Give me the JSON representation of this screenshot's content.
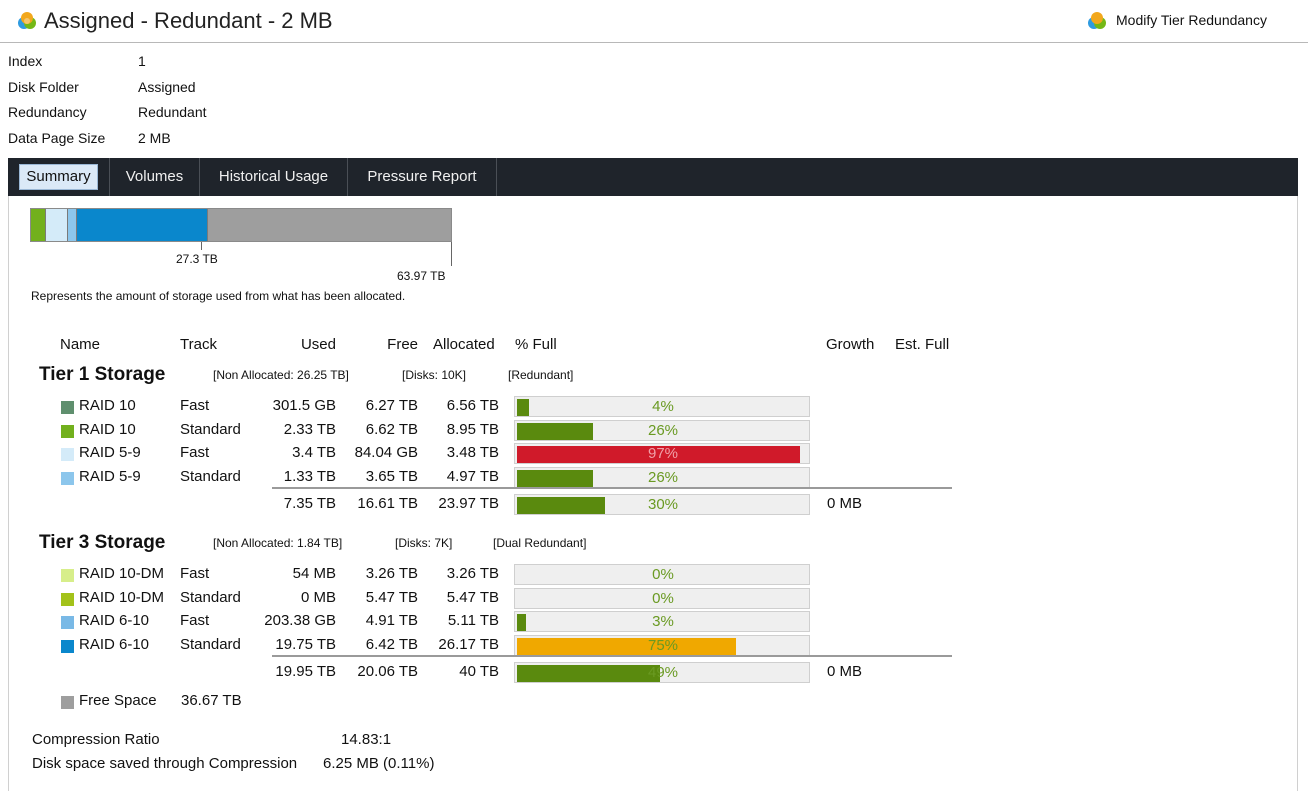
{
  "header": {
    "title": "Assigned - Redundant - 2 MB",
    "modify_label": "Modify Tier Redundancy"
  },
  "properties": [
    {
      "label": "Index",
      "value": "1"
    },
    {
      "label": "Disk Folder",
      "value": "Assigned"
    },
    {
      "label": "Redundancy",
      "value": "Redundant"
    },
    {
      "label": "Data Page Size",
      "value": "2 MB"
    }
  ],
  "tabs": [
    {
      "label": "Summary",
      "active": true
    },
    {
      "label": "Volumes",
      "active": false
    },
    {
      "label": "Historical Usage",
      "active": false
    },
    {
      "label": "Pressure Report",
      "active": false
    }
  ],
  "usage_bar": {
    "used_label": "27.3 TB",
    "allocated_label": "63.97 TB",
    "caption": "Represents the amount of storage used from what has been allocated.",
    "used_fraction": 0.427,
    "segments": [
      {
        "color": "#72b01d",
        "value_tb": 2.33
      },
      {
        "color": "#d4ebf9",
        "value_tb": 3.4
      },
      {
        "color": "#8cc6ec",
        "value_tb": 1.33
      },
      {
        "color": "#0a87cc",
        "value_tb": 19.75
      },
      {
        "color": "#9e9e9e",
        "value_tb": 36.67
      }
    ]
  },
  "columns": {
    "name": "Name",
    "track": "Track",
    "used": "Used",
    "free": "Free",
    "allocated": "Allocated",
    "pct": "% Full",
    "growth": "Growth",
    "est_full": "Est. Full"
  },
  "tiers": [
    {
      "title": "Tier 1 Storage",
      "non_allocated": "[Non Allocated: 26.25 TB]",
      "disks": "[Disks: 10K]",
      "redundancy": "[Redundant]",
      "rows": [
        {
          "name": "RAID 10",
          "color": "#5f8f6e",
          "track": "Fast",
          "used": "301.5 GB",
          "free": "6.27 TB",
          "allocated": "6.56 TB",
          "pct_label": "4%",
          "pct": 4,
          "bar_color": "#5a8a0e"
        },
        {
          "name": "RAID 10",
          "color": "#72b01d",
          "track": "Standard",
          "used": "2.33 TB",
          "free": "6.62 TB",
          "allocated": "8.95 TB",
          "pct_label": "26%",
          "pct": 26,
          "bar_color": "#5a8a0e"
        },
        {
          "name": "RAID 5-9",
          "color": "#d4ebf9",
          "track": "Fast",
          "used": "3.4 TB",
          "free": "84.04 GB",
          "allocated": "3.48 TB",
          "pct_label": "97%",
          "pct": 97,
          "bar_color": "#d01a2a"
        },
        {
          "name": "RAID 5-9",
          "color": "#8cc6ec",
          "track": "Standard",
          "used": "1.33 TB",
          "free": "3.65 TB",
          "allocated": "4.97 TB",
          "pct_label": "26%",
          "pct": 26,
          "bar_color": "#5a8a0e"
        }
      ],
      "total": {
        "used": "7.35 TB",
        "free": "16.61 TB",
        "allocated": "23.97 TB",
        "pct_label": "30%",
        "pct": 30,
        "bar_color": "#5a8a0e",
        "growth": "0 MB"
      }
    },
    {
      "title": "Tier 3 Storage",
      "non_allocated": "[Non Allocated: 1.84 TB]",
      "disks": "[Disks: 7K]",
      "redundancy": "[Dual Redundant]",
      "rows": [
        {
          "name": "RAID 10-DM",
          "color": "#d7ee8a",
          "track": "Fast",
          "used": "54 MB",
          "free": "3.26 TB",
          "allocated": "3.26 TB",
          "pct_label": "0%",
          "pct": 0,
          "bar_color": "#5a8a0e"
        },
        {
          "name": "RAID 10-DM",
          "color": "#a3c21a",
          "track": "Standard",
          "used": "0 MB",
          "free": "5.47 TB",
          "allocated": "5.47 TB",
          "pct_label": "0%",
          "pct": 0,
          "bar_color": "#5a8a0e"
        },
        {
          "name": "RAID 6-10",
          "color": "#79b9e6",
          "track": "Fast",
          "used": "203.38 GB",
          "free": "4.91 TB",
          "allocated": "5.11 TB",
          "pct_label": "3%",
          "pct": 3,
          "bar_color": "#5a8a0e"
        },
        {
          "name": "RAID 6-10",
          "color": "#0a87cc",
          "track": "Standard",
          "used": "19.75 TB",
          "free": "6.42 TB",
          "allocated": "26.17 TB",
          "pct_label": "75%",
          "pct": 75,
          "bar_color": "#f0a800"
        }
      ],
      "total": {
        "used": "19.95 TB",
        "free": "20.06 TB",
        "allocated": "40 TB",
        "pct_label": "49%",
        "pct": 49,
        "bar_color": "#5a8a0e",
        "growth": "0 MB"
      }
    }
  ],
  "free_space": {
    "label": "Free Space",
    "value": "36.67 TB",
    "color": "#9e9e9e"
  },
  "compression": [
    {
      "label": "Compression Ratio",
      "value": "14.83:1"
    },
    {
      "label": "Disk space saved through Compression",
      "value": "6.25 MB (0.11%)"
    }
  ]
}
